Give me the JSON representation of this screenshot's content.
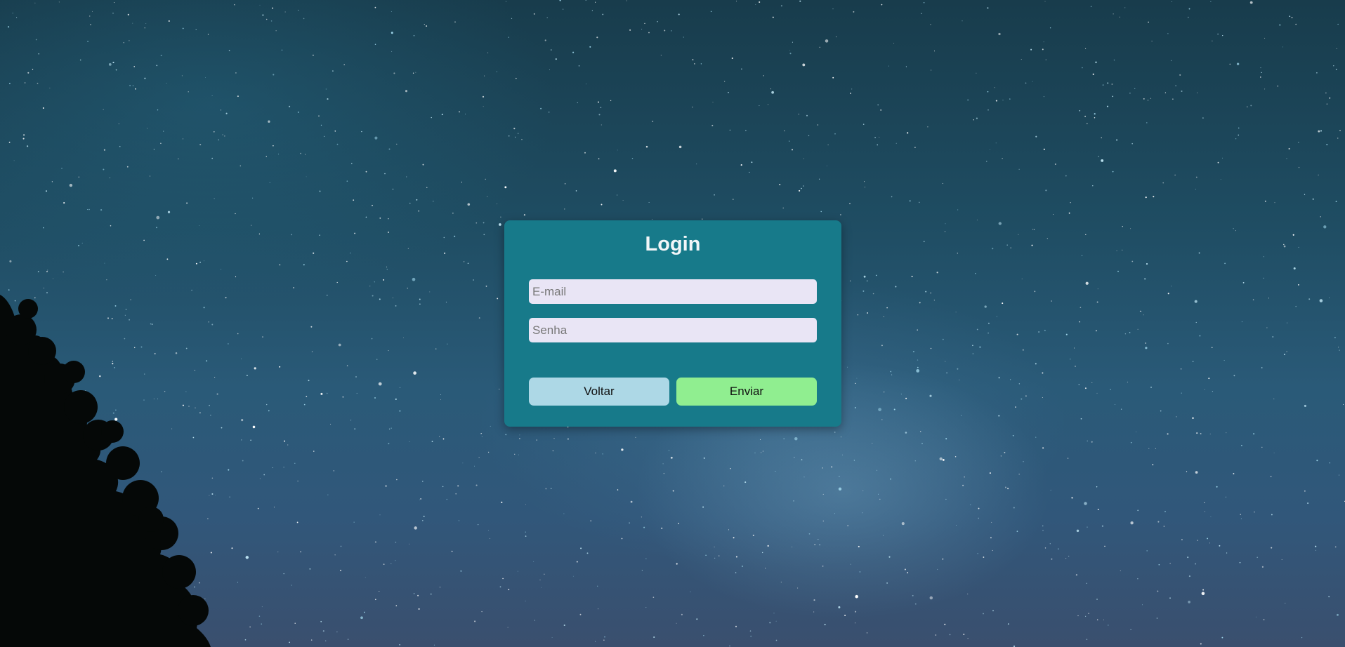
{
  "login": {
    "title": "Login",
    "email_placeholder": "E-mail",
    "email_value": "",
    "password_placeholder": "Senha",
    "password_value": "",
    "back_label": "Voltar",
    "submit_label": "Enviar"
  },
  "colors": {
    "card_background": "#177a8a",
    "input_background": "#e9e5f5",
    "back_button": "#add8e6",
    "submit_button": "#90ee90",
    "title_text": "#f2f6f8"
  }
}
